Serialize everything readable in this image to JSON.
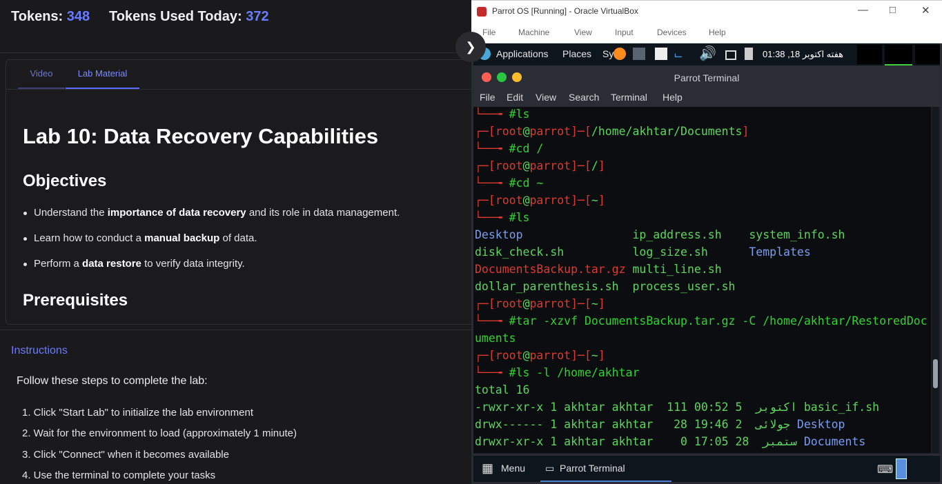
{
  "header": {
    "tokens_label": "Tokens:",
    "tokens_value": "348",
    "used_label": "Tokens Used Today:",
    "used_value": "372"
  },
  "collapse_icon": "chevron-right-icon",
  "tabs": {
    "video": "Video",
    "lab": "Lab Material"
  },
  "lab": {
    "title": "Lab 10: Data Recovery Capabilities",
    "objectives_heading": "Objectives",
    "objectives": [
      {
        "pre": "Understand the ",
        "bold": "importance of data recovery",
        "post": " and its role in data management."
      },
      {
        "pre": "Learn how to conduct a ",
        "bold": "manual backup",
        "post": " of data."
      },
      {
        "pre": "Perform a ",
        "bold": "data restore",
        "post": " to verify data integrity."
      }
    ],
    "prereq_heading": "Prerequisites"
  },
  "instructions": {
    "label": "Instructions",
    "intro": "Follow these steps to complete the lab:",
    "steps": [
      "1. Click \"Start Lab\" to initialize the lab environment",
      "2. Wait for the environment to load (approximately 1 minute)",
      "3. Click \"Connect\" when it becomes available",
      "4. Use the terminal to complete your tasks"
    ]
  },
  "vbox": {
    "title": "Parrot OS [Running] - Oracle VirtualBox",
    "menu": [
      "File",
      "Machine",
      "View",
      "Input",
      "Devices",
      "Help"
    ]
  },
  "panel": {
    "applications": "Applications",
    "places": "Places",
    "system": "Sy",
    "clock": "01:38 ,18 هفته اکتوبر"
  },
  "terminal": {
    "title": "Parrot Terminal",
    "menu": [
      "File",
      "Edit",
      "View",
      "Search",
      "Terminal",
      "Help"
    ],
    "lines": [
      [
        {
          "c": "red",
          "t": "└──╼ "
        },
        {
          "c": "grn",
          "t": "#ls"
        }
      ],
      [
        {
          "c": "red",
          "t": "┌─["
        },
        {
          "c": "red",
          "t": "root"
        },
        {
          "c": "lgn",
          "t": "@"
        },
        {
          "c": "red",
          "t": "parrot"
        },
        {
          "c": "red",
          "t": "]─["
        },
        {
          "c": "lgn",
          "t": "/home/akhtar/Documents"
        },
        {
          "c": "red",
          "t": "]"
        }
      ],
      [
        {
          "c": "red",
          "t": "└──╼ "
        },
        {
          "c": "grn",
          "t": "#cd /"
        }
      ],
      [
        {
          "c": "red",
          "t": "┌─["
        },
        {
          "c": "red",
          "t": "root"
        },
        {
          "c": "lgn",
          "t": "@"
        },
        {
          "c": "red",
          "t": "parrot"
        },
        {
          "c": "red",
          "t": "]─["
        },
        {
          "c": "lgn",
          "t": "/"
        },
        {
          "c": "red",
          "t": "]"
        }
      ],
      [
        {
          "c": "red",
          "t": "└──╼ "
        },
        {
          "c": "grn",
          "t": "#cd ~"
        }
      ],
      [
        {
          "c": "red",
          "t": "┌─["
        },
        {
          "c": "red",
          "t": "root"
        },
        {
          "c": "lgn",
          "t": "@"
        },
        {
          "c": "red",
          "t": "parrot"
        },
        {
          "c": "red",
          "t": "]─["
        },
        {
          "c": "lgn",
          "t": "~"
        },
        {
          "c": "red",
          "t": "]"
        }
      ],
      [
        {
          "c": "red",
          "t": "└──╼ "
        },
        {
          "c": "grn",
          "t": "#ls"
        }
      ],
      [
        {
          "c": "blu",
          "t": "Desktop                "
        },
        {
          "c": "lgn",
          "t": "ip_address.sh    system_info.sh"
        }
      ],
      [
        {
          "c": "lgn",
          "t": "disk_check.sh          log_size.sh      "
        },
        {
          "c": "blu",
          "t": "Templates"
        }
      ],
      [
        {
          "c": "red",
          "t": "DocumentsBackup.tar.gz "
        },
        {
          "c": "lgn",
          "t": "multi_line.sh"
        }
      ],
      [
        {
          "c": "lgn",
          "t": "dollar_parenthesis.sh  process_user.sh"
        }
      ],
      [
        {
          "c": "red",
          "t": "┌─["
        },
        {
          "c": "red",
          "t": "root"
        },
        {
          "c": "lgn",
          "t": "@"
        },
        {
          "c": "red",
          "t": "parrot"
        },
        {
          "c": "red",
          "t": "]─["
        },
        {
          "c": "lgn",
          "t": "~"
        },
        {
          "c": "red",
          "t": "]"
        }
      ],
      [
        {
          "c": "red",
          "t": "└──╼ "
        },
        {
          "c": "grn",
          "t": "#tar -xzvf DocumentsBackup.tar.gz -C /home/akhtar/RestoredDoc"
        }
      ],
      [
        {
          "c": "grn",
          "t": "uments"
        }
      ],
      [
        {
          "c": "red",
          "t": "┌─["
        },
        {
          "c": "red",
          "t": "root"
        },
        {
          "c": "lgn",
          "t": "@"
        },
        {
          "c": "red",
          "t": "parrot"
        },
        {
          "c": "red",
          "t": "]─["
        },
        {
          "c": "lgn",
          "t": "~"
        },
        {
          "c": "red",
          "t": "]"
        }
      ],
      [
        {
          "c": "red",
          "t": "└──╼ "
        },
        {
          "c": "grn",
          "t": "#ls -l /home/akhtar"
        }
      ],
      [
        {
          "c": "lgn",
          "t": "total 16"
        }
      ],
      [
        {
          "c": "lgn",
          "t": "-rwxr-xr-x 1 akhtar akhtar  111 00:52 5  اکتوبر basic_if.sh"
        }
      ],
      [
        {
          "c": "lgn",
          "t": "drwx------ 1 akhtar akhtar   28 19:46 2  جولائی "
        },
        {
          "c": "blu",
          "t": "Desktop"
        }
      ],
      [
        {
          "c": "lgn",
          "t": "drwxr-xr-x 1 akhtar akhtar    0 17:05 28  ستمبر "
        },
        {
          "c": "blu",
          "t": "Documents"
        }
      ]
    ]
  },
  "taskbar": {
    "menu": "Menu",
    "active": "Parrot Terminal"
  }
}
